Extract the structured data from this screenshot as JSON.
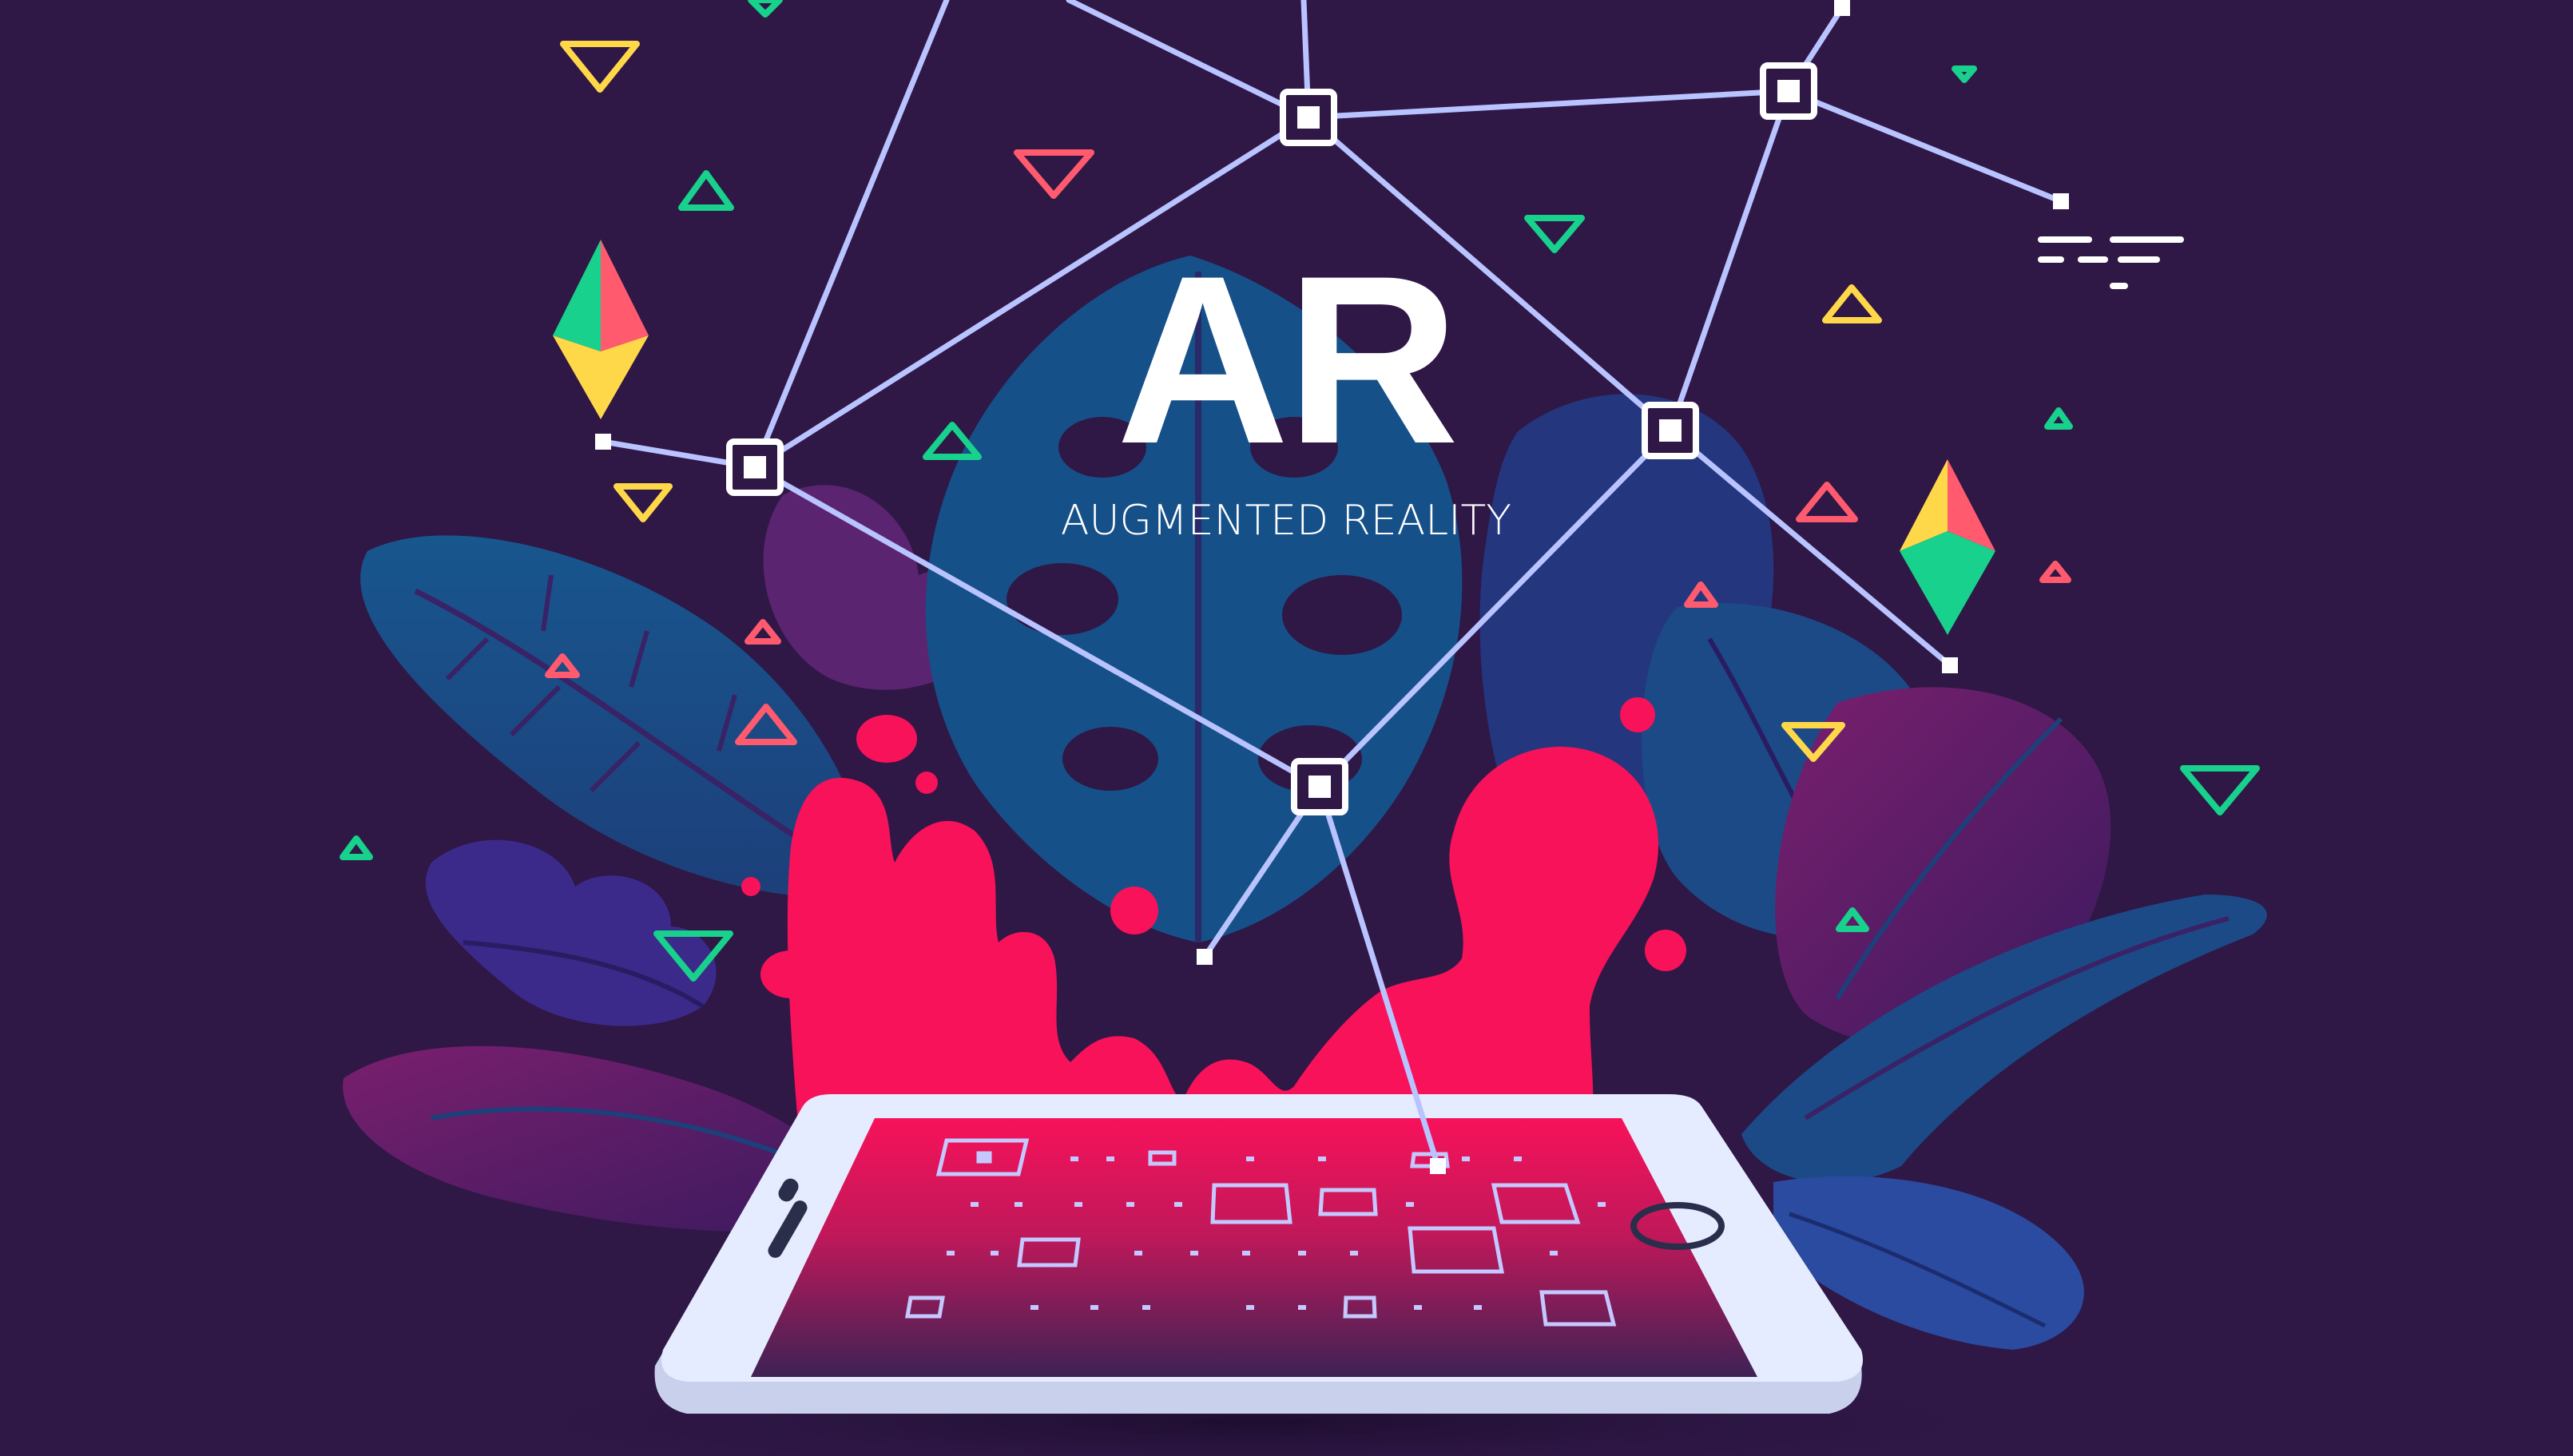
{
  "title": "AR",
  "subtitle": "AUGMENTED REALITY",
  "colors": {
    "background": "#2f1746",
    "splash": "#f7125a",
    "network_lines": "#b8c3ff",
    "phone_body": "#e6ecff",
    "leaf_blue": "#165088",
    "leaf_purple": "#4a2373",
    "accent_green": "#17d18c",
    "accent_yellow": "#ffd84a",
    "accent_coral": "#ff5a6e"
  },
  "icons": [
    "phone-illustration",
    "network-node",
    "triangle-decor",
    "gem-icon",
    "leaf-foliage",
    "paint-splash",
    "ar-marker"
  ]
}
